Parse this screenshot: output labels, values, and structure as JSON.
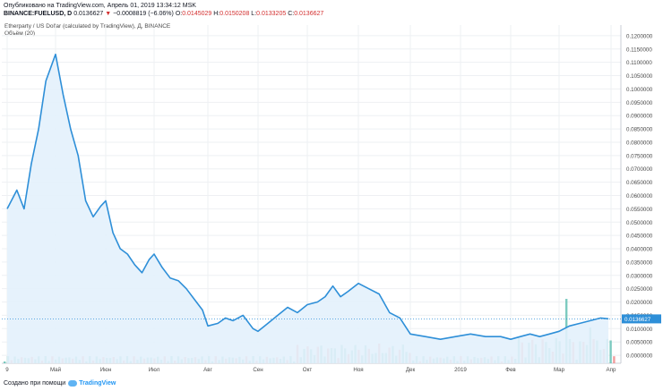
{
  "header": {
    "published": "Опубликовано на TradingView.com, Апрель 01, 2019 13:34:12 MSK",
    "symbol": "BINANCE:FUELUSD, D",
    "last": "0.0136627",
    "change_arrow": "▼",
    "change": "−0.0008819 (−6.06%)",
    "o_label": "O:",
    "o_val": "0.0145029",
    "h_label": "H:",
    "h_val": "0.0150208",
    "l_label": "L:",
    "l_val": "0.0133205",
    "c_label": "C:",
    "c_val": "0.0136627"
  },
  "study": {
    "title": "Etherparty / US Dollar (calculated by TradingView), Д, BINANCE",
    "volume": "Объём (20)"
  },
  "footer": {
    "created": "Создано при помощи",
    "brand": "TradingView"
  },
  "colors": {
    "line": "#2e8fd8",
    "area": "#e3f1fc",
    "vol_up": "#66c2b5",
    "vol_down": "#f08c8c",
    "grid": "#eef0f3",
    "badge": "#2e8fd8"
  },
  "chart_data": {
    "type": "line",
    "xlabels": [
      "9",
      "Май",
      "Июн",
      "Июл",
      "Авг",
      "Сен",
      "Окт",
      "Ноя",
      "Дек",
      "2019",
      "Фев",
      "Мар",
      "Апр"
    ],
    "ylabels": [
      "0.1200000",
      "0.1150000",
      "0.1100000",
      "0.1050000",
      "0.1000000",
      "0.0950000",
      "0.0900000",
      "0.0850000",
      "0.0800000",
      "0.0750000",
      "0.0700000",
      "0.0650000",
      "0.0600000",
      "0.0550000",
      "0.0500000",
      "0.0450000",
      "0.0400000",
      "0.0350000",
      "0.0300000",
      "0.0250000",
      "0.0200000",
      "0.0150000",
      "0.0100000",
      "0.0050000",
      "0.0000000"
    ],
    "ylim": [
      -0.003,
      0.124
    ],
    "last_value_label": "0.0136627",
    "last_value": 0.0136627,
    "x_month_index": [
      0,
      0.2,
      0.35,
      0.5,
      0.65,
      0.8,
      1.0,
      1.15,
      1.3,
      1.45,
      1.6,
      1.75,
      1.9,
      2.0,
      2.15,
      2.3,
      2.45,
      2.6,
      2.75,
      2.9,
      3.0,
      3.15,
      3.3,
      3.45,
      3.6,
      3.75,
      3.9,
      4.0,
      4.2,
      4.35,
      4.5,
      4.7,
      4.9,
      5.0,
      5.2,
      5.4,
      5.6,
      5.8,
      6.0,
      6.2,
      6.35,
      6.5,
      6.65,
      6.8,
      7.0,
      7.2,
      7.4,
      7.6,
      7.8,
      8.0,
      8.3,
      8.6,
      8.9,
      9.2,
      9.5,
      9.8,
      10.0,
      10.2,
      10.4,
      10.6,
      10.8,
      11.0,
      11.2,
      11.4,
      11.6,
      11.8,
      11.95
    ],
    "values": [
      0.055,
      0.062,
      0.055,
      0.072,
      0.085,
      0.103,
      0.113,
      0.098,
      0.085,
      0.075,
      0.058,
      0.052,
      0.056,
      0.058,
      0.046,
      0.04,
      0.038,
      0.034,
      0.031,
      0.036,
      0.038,
      0.033,
      0.029,
      0.028,
      0.025,
      0.021,
      0.017,
      0.011,
      0.012,
      0.014,
      0.013,
      0.015,
      0.01,
      0.009,
      0.012,
      0.015,
      0.018,
      0.016,
      0.019,
      0.02,
      0.022,
      0.026,
      0.022,
      0.024,
      0.027,
      0.025,
      0.023,
      0.016,
      0.014,
      0.008,
      0.007,
      0.006,
      0.007,
      0.008,
      0.007,
      0.007,
      0.006,
      0.007,
      0.008,
      0.007,
      0.008,
      0.009,
      0.011,
      0.012,
      0.013,
      0.014,
      0.0137
    ]
  }
}
